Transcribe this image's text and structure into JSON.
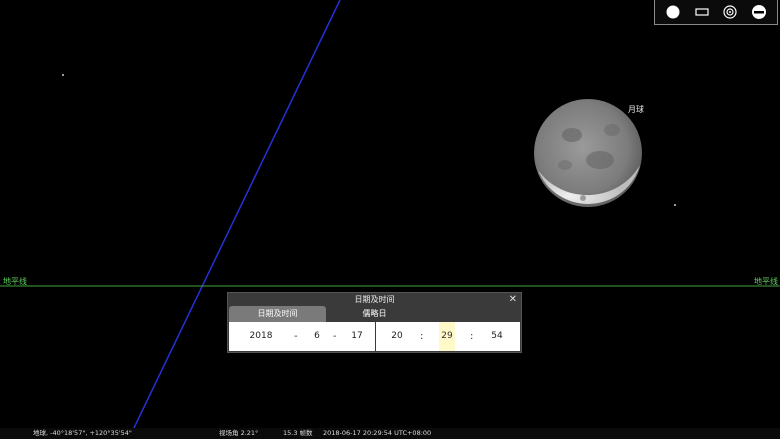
{
  "sky": {
    "moon_label": "月球",
    "horizon_label_left": "地平线",
    "horizon_label_right": "地平线"
  },
  "toolbar": {
    "buttons": [
      "full-disk-icon",
      "rectangle-icon",
      "target-icon",
      "horizon-toggle-icon"
    ]
  },
  "dialog": {
    "title": "日期及时间",
    "close": "✕",
    "tabs": [
      "日期及时间",
      "儒略日"
    ],
    "date": {
      "year": "2018",
      "month": "6",
      "day": "17"
    },
    "time": {
      "hour": "20",
      "minute": "29",
      "second": "54"
    },
    "date_separator": "-",
    "time_separator": ":"
  },
  "status": {
    "location": "地球, -40°18'57\", +120°35'54\"",
    "fov": "视场角 2.21°",
    "fps": "15.3 帧数",
    "datetime": "2018-06-17 20:29:54 UTC+08:00"
  },
  "colors": {
    "horizon": "#3fa53f",
    "meridian": "#2430d8",
    "panel": "#3a3a3a"
  }
}
